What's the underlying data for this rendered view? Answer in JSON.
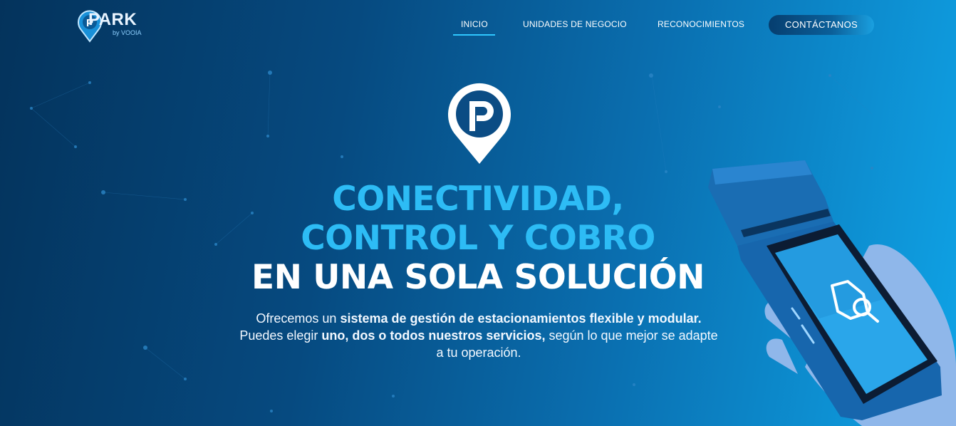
{
  "brand": {
    "logo_text": "PARK",
    "logo_sub": "by VOOIA"
  },
  "nav": {
    "items": [
      {
        "label": "INICIO"
      },
      {
        "label": "UNIDADES DE NEGOCIO"
      },
      {
        "label": "RECONOCIMIENTOS"
      }
    ],
    "contact_label": "CONTÁCTANOS"
  },
  "hero": {
    "line1": "CONECTIVIDAD,",
    "line2": "CONTROL Y COBRO",
    "line3": "EN UNA SOLA SOLUCIÓN",
    "desc": {
      "t1": "Ofrecemos un ",
      "b1": "sistema de gestión de estacionamientos flexible y modular.",
      "t2": " Puedes elegir ",
      "b2": "uno, dos o todos nuestros servicios,",
      "t3": " según lo que mejor se adapte a tu operación."
    }
  },
  "icons": [
    "park-pin-icon",
    "car-search-icon",
    "logo-pin-icon"
  ],
  "colors": {
    "accent": "#2dbcf5",
    "bg_dark": "#04335c",
    "bg_light": "#0fa3e6"
  }
}
